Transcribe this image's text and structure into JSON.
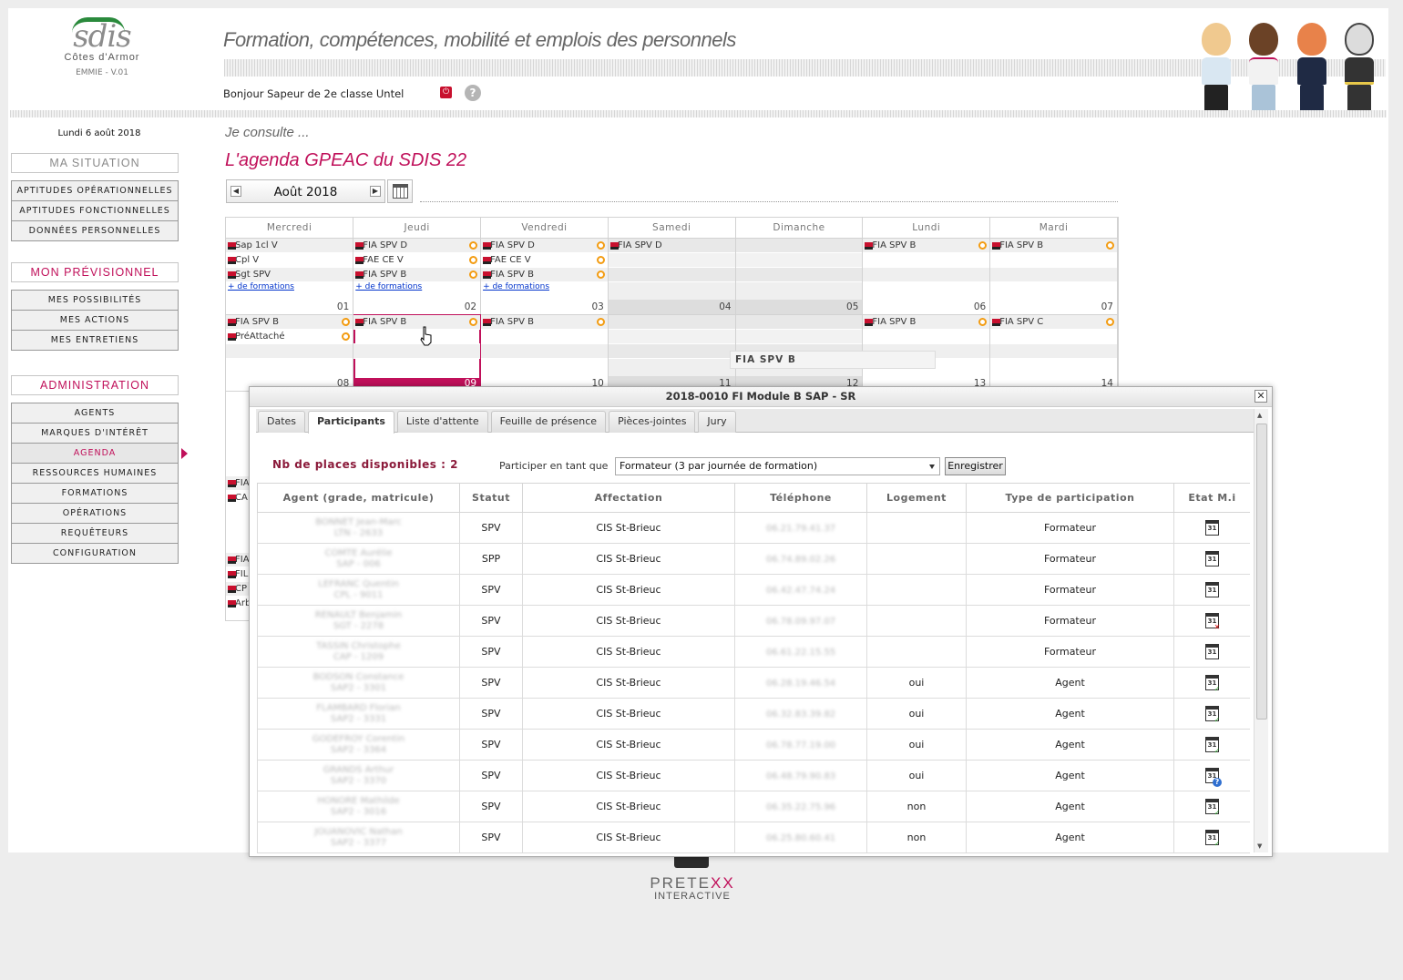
{
  "header": {
    "logo_text": "sdis",
    "logo_sub": "Côtes d'Armor",
    "version": "EMMIE - V.01",
    "headline": "Formation, compétences, mobilité et emplois des personnels",
    "greeting": "Bonjour Sapeur de 2e classe Untel",
    "icons": [
      "power-icon",
      "help-icon"
    ]
  },
  "sidebar": {
    "date": "Lundi 6 août 2018",
    "sections": [
      {
        "title": "MA SITUATION",
        "title_color": "#8a8a8a",
        "items": [
          "APTITUDES OPÉRATIONNELLES",
          "APTITUDES FONCTIONNELLES",
          "DONNÉES PERSONNELLES"
        ]
      },
      {
        "title": "MON PRÉVISIONNEL",
        "title_color": "#c0105a",
        "items": [
          "MES POSSIBILITÉS",
          "MES ACTIONS",
          "MES ENTRETIENS"
        ]
      },
      {
        "title": "ADMINISTRATION",
        "title_color": "#c0105a",
        "items": [
          "AGENTS",
          "MARQUES D'INTÉRÊT",
          "AGENDA",
          "RESSOURCES HUMAINES",
          "FORMATIONS",
          "OPÉRATIONS",
          "REQUÊTEURS",
          "CONFIGURATION"
        ],
        "active": "AGENDA"
      }
    ]
  },
  "main": {
    "consult": "Je consulte ...",
    "title": "L'agenda GPEAC du SDIS 22",
    "month": "Août 2018",
    "days": [
      "Mercredi",
      "Jeudi",
      "Vendredi",
      "Samedi",
      "Dimanche",
      "Lundi",
      "Mardi"
    ],
    "more_link": "+ de formations",
    "weeks": [
      [
        {
          "num": "01",
          "events": [
            "Sap 1cl V",
            "Cpl V",
            "Sgt SPV"
          ],
          "more": true,
          "ring": false
        },
        {
          "num": "02",
          "events": [
            "FIA SPV D",
            "FAE CE V",
            "FIA SPV B"
          ],
          "more": true,
          "ring": true
        },
        {
          "num": "03",
          "events": [
            "FIA SPV D",
            "FAE CE V",
            "FIA SPV B"
          ],
          "more": true,
          "ring": true
        },
        {
          "num": "04",
          "events": [
            "FIA SPV D"
          ],
          "weekend": true
        },
        {
          "num": "05",
          "events": [],
          "weekend": true
        },
        {
          "num": "06",
          "events": [
            "FIA SPV B"
          ],
          "ring": true
        },
        {
          "num": "07",
          "events": [
            "FIA SPV B"
          ],
          "ring": true
        }
      ],
      [
        {
          "num": "08",
          "events": [
            "FIA SPV B",
            "PréAttaché"
          ],
          "ring": true
        },
        {
          "num": "09",
          "events": [
            "FIA SPV B"
          ],
          "ring": true,
          "selected": true
        },
        {
          "num": "10",
          "events": [
            "FIA SPV B"
          ],
          "ring": true
        },
        {
          "num": "11",
          "events": [],
          "weekend": true
        },
        {
          "num": "12",
          "events": [],
          "weekend": true
        },
        {
          "num": "13",
          "events": [
            "FIA SPV B"
          ],
          "ring": true
        },
        {
          "num": "14",
          "events": [
            "FIA SPV C"
          ],
          "ring": true
        }
      ]
    ],
    "partial_rows": [
      [
        "FIA",
        "CA"
      ],
      [
        "FIA",
        "FIL",
        "CP",
        "Arb"
      ]
    ],
    "tooltip": "FIA SPV B"
  },
  "modal": {
    "title": "2018-0010 FI Module B SAP - SR",
    "tabs": [
      "Dates",
      "Participants",
      "Liste d'attente",
      "Feuille de présence",
      "Pièces-jointes",
      "Jury"
    ],
    "active_tab": "Participants",
    "places": "Nb de places disponibles : 2",
    "participate_label": "Participer en tant que",
    "participate_value": "Formateur (3 par journée de formation)",
    "save": "Enregistrer",
    "columns": [
      "Agent (grade, matricule)",
      "Statut",
      "Affectation",
      "Téléphone",
      "Logement",
      "Type de participation",
      "Etat M.i"
    ],
    "rows": [
      {
        "name": "BONNET Jean-Marc",
        "id": "LTN - 2633",
        "statut": "SPV",
        "aff": "CIS St-Brieuc",
        "tel": "06.21.79.41.37",
        "log": "",
        "type": "Formateur",
        "etat": "calendar"
      },
      {
        "name": "COMTE Aurélie",
        "id": "SAP - 006",
        "statut": "SPP",
        "aff": "CIS St-Brieuc",
        "tel": "06.74.89.02.26",
        "log": "",
        "type": "Formateur",
        "etat": "calendar"
      },
      {
        "name": "LEFRANC Quentin",
        "id": "CPL - 9011",
        "statut": "SPV",
        "aff": "CIS St-Brieuc",
        "tel": "06.42.47.74.24",
        "log": "",
        "type": "Formateur",
        "etat": "calendar"
      },
      {
        "name": "RENAULT Benjamin",
        "id": "SGT - 2278",
        "statut": "SPV",
        "aff": "CIS St-Brieuc",
        "tel": "06.78.09.97.07",
        "log": "",
        "type": "Formateur",
        "etat": "calendar-refused"
      },
      {
        "name": "TASSIN Christophe",
        "id": "CAP - 1209",
        "statut": "SPV",
        "aff": "CIS St-Brieuc",
        "tel": "06.61.22.15.55",
        "log": "",
        "type": "Formateur",
        "etat": "calendar"
      },
      {
        "name": "BODSON Constance",
        "id": "SAP2 - 3301",
        "statut": "SPV",
        "aff": "CIS St-Brieuc",
        "tel": "06.28.19.46.54",
        "log": "oui",
        "type": "Agent",
        "etat": "calendar-validated"
      },
      {
        "name": "FLAMBARD Florian",
        "id": "SAP2 - 3331",
        "statut": "SPV",
        "aff": "CIS St-Brieuc",
        "tel": "06.32.83.39.82",
        "log": "oui",
        "type": "Agent",
        "etat": "calendar-validated"
      },
      {
        "name": "GODEFROY Corentin",
        "id": "SAP2 - 3364",
        "statut": "SPV",
        "aff": "CIS St-Brieuc",
        "tel": "06.78.77.19.00",
        "log": "oui",
        "type": "Agent",
        "etat": "calendar-validated"
      },
      {
        "name": "GRANDS Arthur",
        "id": "SAP2 - 3370",
        "statut": "SPV",
        "aff": "CIS St-Brieuc",
        "tel": "06.48.79.90.83",
        "log": "oui",
        "type": "Agent",
        "etat": "calendar-pending"
      },
      {
        "name": "HONORE Mathilde",
        "id": "SAP2 - 3016",
        "statut": "SPV",
        "aff": "CIS St-Brieuc",
        "tel": "06.35.22.75.96",
        "log": "non",
        "type": "Agent",
        "etat": "calendar-validated"
      },
      {
        "name": "JOUANOVIC Nathan",
        "id": "SAP2 - 3377",
        "statut": "SPV",
        "aff": "CIS St-Brieuc",
        "tel": "06.25.80.60.41",
        "log": "non",
        "type": "Agent",
        "etat": "calendar-validated"
      }
    ]
  },
  "footer": {
    "brand1": "PRETE",
    "brand2": "XX",
    "brand3": "INTERACTIVE"
  }
}
